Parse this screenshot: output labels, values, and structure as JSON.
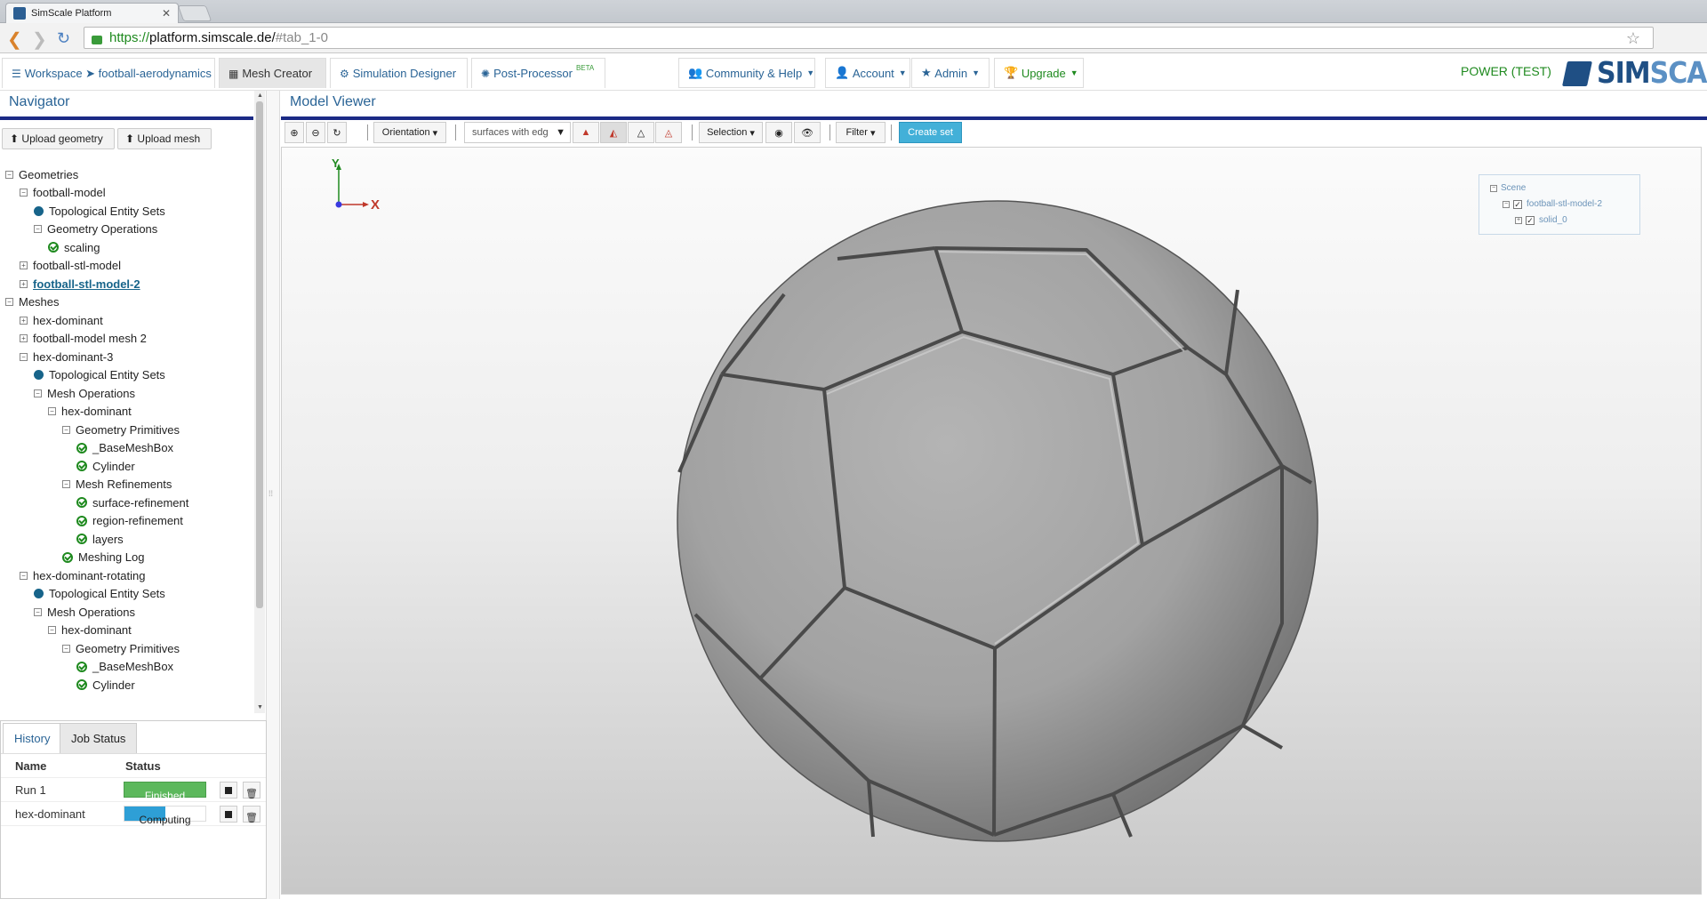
{
  "browser": {
    "tab_title": "SimScale Platform",
    "url_scheme": "https://",
    "url_host": "platform.simscale.de/",
    "url_hash": "#tab_1-0"
  },
  "header": {
    "tabs": [
      {
        "label": "Workspace ➤ football-aerodynamics",
        "icon": "list-icon"
      },
      {
        "label": "Mesh Creator",
        "icon": "grid-icon"
      },
      {
        "label": "Simulation Designer",
        "icon": "gears-icon"
      },
      {
        "label": "Post-Processor",
        "icon": "cog-icon",
        "badge": "BETA"
      }
    ],
    "menus": [
      {
        "label": "Community & Help",
        "icon": "users-icon"
      },
      {
        "label": "Account",
        "icon": "user-icon"
      },
      {
        "label": "Admin",
        "icon": "star-icon"
      },
      {
        "label": "Upgrade",
        "icon": "trophy-icon"
      }
    ],
    "plan": "POWER (TEST)",
    "logo_sim": "SIM",
    "logo_scale": "SCALE"
  },
  "navigator": {
    "title": "Navigator",
    "upload_geometry": "Upload geometry",
    "upload_mesh": "Upload mesh",
    "tree": [
      {
        "label": "Geometries",
        "level": 0,
        "type": "minus"
      },
      {
        "label": "football-model",
        "level": 1,
        "type": "minus"
      },
      {
        "label": "Topological Entity Sets",
        "level": 2,
        "type": "dot"
      },
      {
        "label": "Geometry Operations",
        "level": 2,
        "type": "minus"
      },
      {
        "label": "scaling",
        "level": 3,
        "type": "check"
      },
      {
        "label": "football-stl-model",
        "level": 1,
        "type": "plus"
      },
      {
        "label": "football-stl-model-2",
        "level": 1,
        "type": "plus",
        "selected": true
      },
      {
        "label": "Meshes",
        "level": 0,
        "type": "minus"
      },
      {
        "label": "hex-dominant",
        "level": 1,
        "type": "plus"
      },
      {
        "label": "football-model mesh 2",
        "level": 1,
        "type": "plus"
      },
      {
        "label": "hex-dominant-3",
        "level": 1,
        "type": "minus"
      },
      {
        "label": "Topological Entity Sets",
        "level": 2,
        "type": "dot"
      },
      {
        "label": "Mesh Operations",
        "level": 2,
        "type": "minus"
      },
      {
        "label": "hex-dominant",
        "level": 3,
        "type": "minus"
      },
      {
        "label": "Geometry Primitives",
        "level": 4,
        "type": "minus"
      },
      {
        "label": "_BaseMeshBox",
        "level": 5,
        "type": "check"
      },
      {
        "label": "Cylinder",
        "level": 5,
        "type": "check"
      },
      {
        "label": "Mesh Refinements",
        "level": 4,
        "type": "minus"
      },
      {
        "label": "surface-refinement",
        "level": 5,
        "type": "check"
      },
      {
        "label": "region-refinement",
        "level": 5,
        "type": "check"
      },
      {
        "label": "layers",
        "level": 5,
        "type": "check"
      },
      {
        "label": "Meshing Log",
        "level": 4,
        "type": "check"
      },
      {
        "label": "hex-dominant-rotating",
        "level": 1,
        "type": "minus"
      },
      {
        "label": "Topological Entity Sets",
        "level": 2,
        "type": "dot"
      },
      {
        "label": "Mesh Operations",
        "level": 2,
        "type": "minus"
      },
      {
        "label": "hex-dominant",
        "level": 3,
        "type": "minus"
      },
      {
        "label": "Geometry Primitives",
        "level": 4,
        "type": "minus"
      },
      {
        "label": "_BaseMeshBox",
        "level": 5,
        "type": "check"
      },
      {
        "label": "Cylinder",
        "level": 5,
        "type": "check"
      }
    ]
  },
  "jobs": {
    "tab_history": "History",
    "tab_job_status": "Job Status",
    "col_name": "Name",
    "col_status": "Status",
    "rows": [
      {
        "name": "Run 1",
        "status": "Finished",
        "progress": 1.0
      },
      {
        "name": "hex-dominant",
        "status": "Computing",
        "progress": 0.5
      }
    ]
  },
  "viewer": {
    "title": "Model Viewer",
    "orientation": "Orientation",
    "render_mode": "surfaces with edg",
    "selection": "Selection",
    "filter": "Filter",
    "create_set": "Create set",
    "axis_x": "X",
    "axis_y": "Y",
    "scene": {
      "root": "Scene",
      "model": "football-stl-model-2",
      "solid": "solid_0"
    }
  }
}
